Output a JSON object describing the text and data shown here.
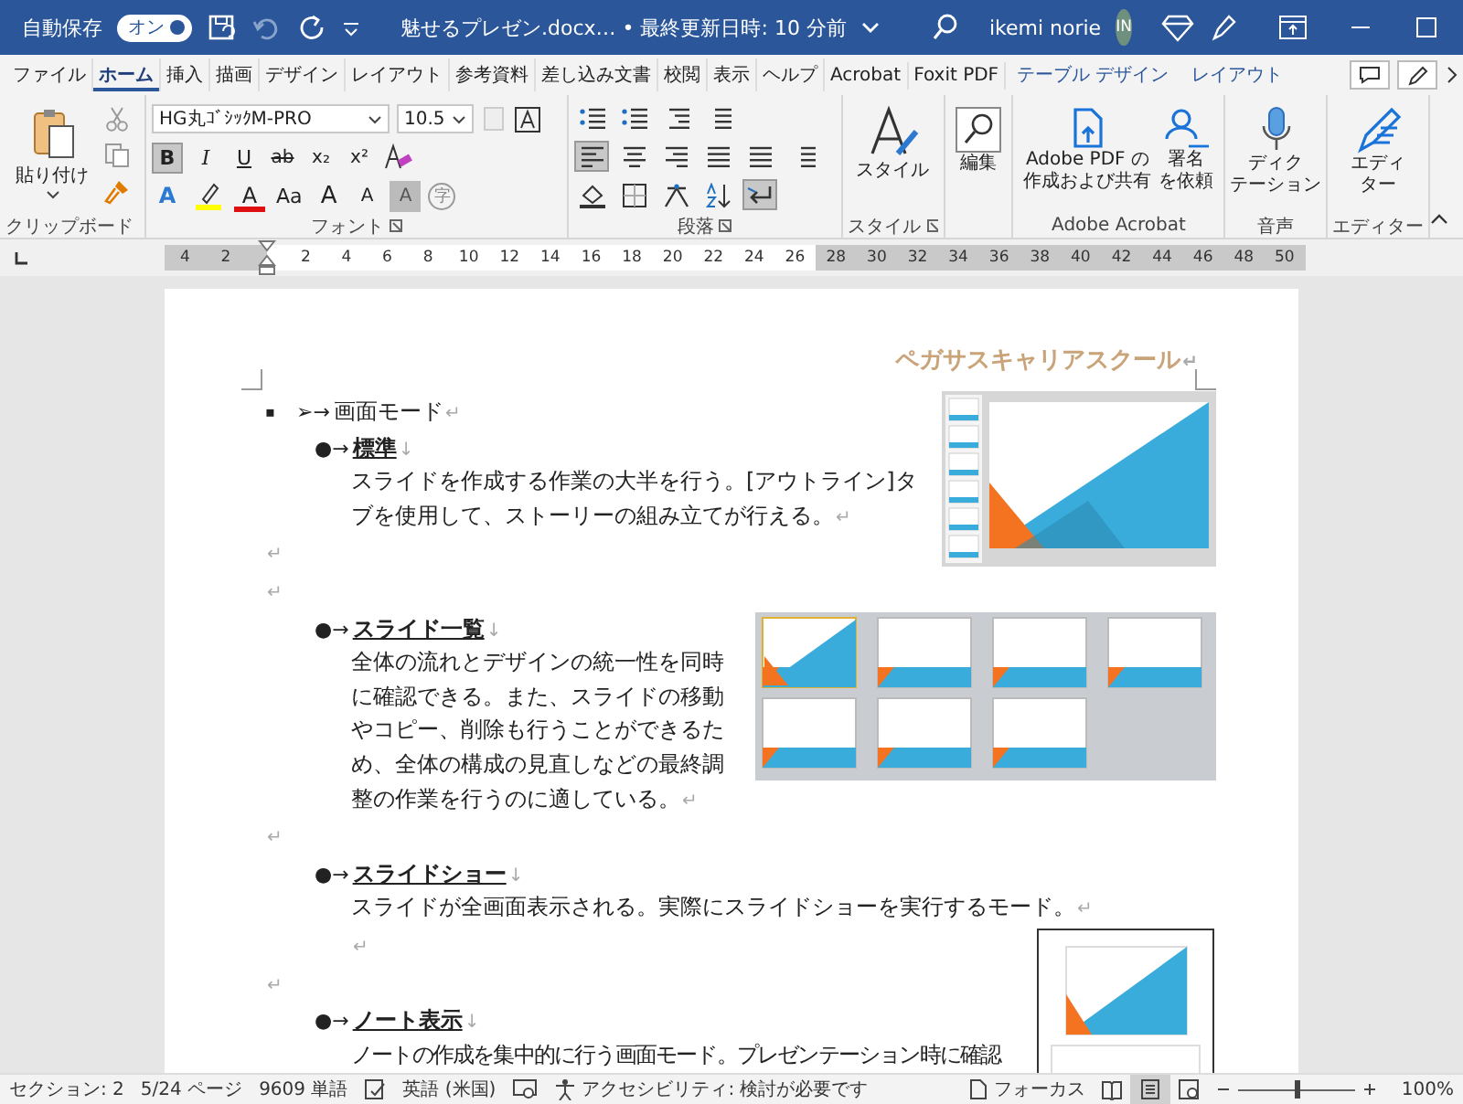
{
  "title_bar": {
    "autosave_label": "自動保存",
    "autosave_toggle": {
      "label": "オン",
      "on": true
    },
    "file_title": "魅せるプレゼン.docx… • 最終更新日時: 10 分前",
    "user_name": "ikemi norie",
    "avatar_initials": "IN"
  },
  "ribbon_tabs": [
    {
      "label": "ファイル",
      "selected": false,
      "kind": "normal"
    },
    {
      "label": "ホーム",
      "selected": true,
      "kind": "normal"
    },
    {
      "label": "挿入",
      "selected": false,
      "kind": "normal"
    },
    {
      "label": "描画",
      "selected": false,
      "kind": "normal"
    },
    {
      "label": "デザイン",
      "selected": false,
      "kind": "normal"
    },
    {
      "label": "レイアウト",
      "selected": false,
      "kind": "normal"
    },
    {
      "label": "参考資料",
      "selected": false,
      "kind": "normal"
    },
    {
      "label": "差し込み文書",
      "selected": false,
      "kind": "normal"
    },
    {
      "label": "校閲",
      "selected": false,
      "kind": "normal"
    },
    {
      "label": "表示",
      "selected": false,
      "kind": "normal"
    },
    {
      "label": "ヘルプ",
      "selected": false,
      "kind": "normal"
    },
    {
      "label": "Acrobat",
      "selected": false,
      "kind": "normal"
    },
    {
      "label": "Foxit PDF",
      "selected": false,
      "kind": "normal"
    },
    {
      "label": "テーブル デザイン",
      "selected": false,
      "kind": "contextual"
    },
    {
      "label": "レイアウト",
      "selected": false,
      "kind": "contextual"
    }
  ],
  "ribbon": {
    "clipboard": {
      "paste_label": "貼り付け",
      "label": "クリップボード"
    },
    "font": {
      "font_name": "HG丸ｺﾞｼｯｸM-PRO",
      "font_size": "10.5",
      "label": "フォント",
      "style_buttons": [
        {
          "kind": "bold",
          "label": "B",
          "selected": true
        },
        {
          "kind": "italic",
          "label": "I",
          "selected": false
        },
        {
          "kind": "underline",
          "label": "U",
          "selected": false
        },
        {
          "kind": "strike",
          "label": "ab",
          "selected": false
        },
        {
          "kind": "sub",
          "label": "x₂",
          "selected": false
        },
        {
          "kind": "sup",
          "label": "x²",
          "selected": false
        }
      ],
      "effect_buttons": [
        {
          "kind": "effect",
          "label": "A"
        },
        {
          "kind": "highlight"
        },
        {
          "kind": "color",
          "label": "A"
        },
        {
          "kind": "case",
          "label": "Aa"
        },
        {
          "kind": "grow",
          "label": "A"
        },
        {
          "kind": "shrink",
          "label": "A"
        },
        {
          "kind": "shade",
          "label": "A"
        },
        {
          "kind": "enclose",
          "label": "字"
        }
      ]
    },
    "paragraph": {
      "label": "段落",
      "rows": [
        [
          {
            "kind": "bullets",
            "selected": false
          },
          {
            "kind": "numbering",
            "selected": false
          },
          {
            "kind": "multilevel",
            "selected": false
          },
          {
            "kind": "indent",
            "selected": false
          }
        ],
        [
          {
            "kind": "align_left",
            "selected": true
          },
          {
            "kind": "align_center",
            "selected": false
          },
          {
            "kind": "align_right",
            "selected": false
          },
          {
            "kind": "justify",
            "selected": false
          },
          {
            "kind": "distribute",
            "selected": false
          },
          {
            "kind": "line_spacing",
            "selected": false
          }
        ],
        [
          {
            "kind": "shading",
            "selected": false
          },
          {
            "kind": "borders",
            "selected": false
          },
          {
            "kind": "asian_layout",
            "selected": false
          },
          {
            "kind": "sort",
            "selected": false
          },
          {
            "kind": "show_marks",
            "selected": true
          }
        ]
      ]
    },
    "styles": {
      "button": "スタイル",
      "label": "スタイル"
    },
    "editing": {
      "button": "編集"
    },
    "adobe": {
      "buttons": [
        {
          "kind": "pdf",
          "lines": [
            "Adobe PDF の",
            "作成および共有"
          ]
        },
        {
          "kind": "sign",
          "lines": [
            "署名",
            "を依頼"
          ]
        }
      ],
      "label": "Adobe Acrobat"
    },
    "voice": {
      "lines": [
        "ディク",
        "テーション"
      ],
      "label": "音声"
    },
    "editor": {
      "lines": [
        "エディ",
        "ター"
      ],
      "label": "エディター"
    }
  },
  "ruler": {
    "left_margin_labels": [
      "4",
      "2"
    ],
    "body_labels": [
      "2",
      "4",
      "6",
      "8",
      "10",
      "12",
      "14",
      "16",
      "18",
      "20",
      "22",
      "24",
      "26"
    ],
    "right_margin_labels": [
      "28",
      "30",
      "32",
      "34",
      "36",
      "38",
      "40",
      "42",
      "44",
      "46",
      "48",
      "50"
    ]
  },
  "document": {
    "header": "ペガサスキャリアスクール",
    "header_mark": "↵",
    "blocks": [
      {
        "kind": "heading",
        "bullet": "▪",
        "marker": "➢→",
        "text": "画面モード",
        "mark": "↵",
        "picture": {
          "kind": "normal_view"
        }
      },
      {
        "kind": "term",
        "marker": "●→",
        "text": "標準",
        "mark": "↓"
      },
      {
        "kind": "body",
        "text": "スライドを作成する作業の大半を行う。[アウトライン]タブを使用して、ストーリーの組み立てが行える。",
        "mark": "↵"
      },
      {
        "kind": "empty",
        "mark": "↵",
        "indented": false
      },
      {
        "kind": "empty",
        "mark": "↵",
        "indented": false
      },
      {
        "kind": "term",
        "marker": "●→",
        "text": "スライド一覧",
        "mark": "↓",
        "picture": {
          "kind": "slide_sorter"
        }
      },
      {
        "kind": "body",
        "text": "全体の流れとデザインの統一性を同時に確認できる。また、スライドの移動やコピー、削除も行うことができるため、全体の構成の見直しなどの最終調整の作業を行うのに適している。",
        "mark": "↵"
      },
      {
        "kind": "empty",
        "mark": "↵",
        "indented": false
      },
      {
        "kind": "term",
        "marker": "●→",
        "text": "スライドショー",
        "mark": "↓"
      },
      {
        "kind": "body",
        "text": "スライドが全画面表示される。実際にスライドショーを実行するモード。",
        "mark": "↵"
      },
      {
        "kind": "empty",
        "mark": "↵",
        "indented": true,
        "picture": {
          "kind": "notes_page"
        }
      },
      {
        "kind": "empty",
        "mark": "↵",
        "indented": false
      },
      {
        "kind": "term",
        "marker": "●→",
        "text": "ノート表示",
        "mark": "↓"
      },
      {
        "kind": "body_line",
        "text": "ノートの作成を集中的に行う画面モード。プレゼンテーション時に確認"
      }
    ]
  },
  "status_bar": {
    "section": "セクション: 2",
    "page": "5/24 ページ",
    "words": "9609 単語",
    "language": "英語 (米国)",
    "accessibility": "アクセシビリティ: 検討が必要です",
    "focus": "フォーカス",
    "views": [
      {
        "kind": "read",
        "selected": false
      },
      {
        "kind": "print",
        "selected": true
      },
      {
        "kind": "web",
        "selected": false
      }
    ],
    "zoom": {
      "level": 0.5,
      "label": "100%"
    }
  }
}
